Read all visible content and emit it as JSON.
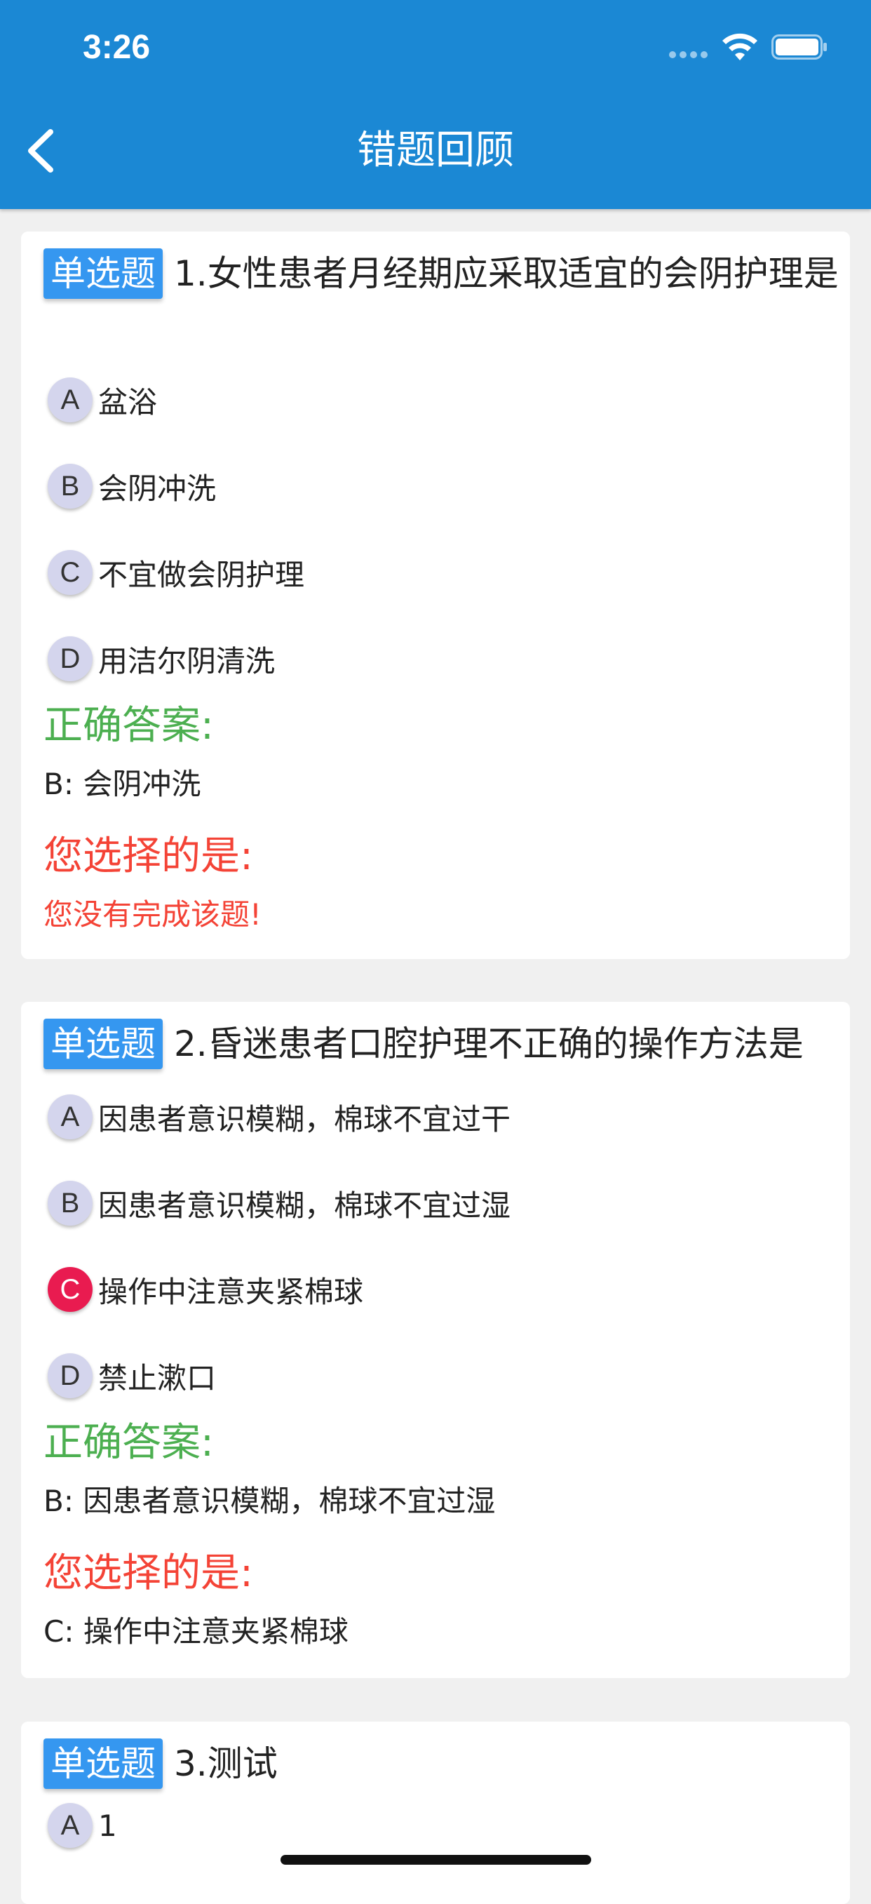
{
  "status_bar": {
    "time": "3:26",
    "icons": [
      "signal-icon",
      "wifi-icon",
      "battery-icon"
    ]
  },
  "header": {
    "title": "错题回顾",
    "back_icon": "chevron-left-icon"
  },
  "colors": {
    "header_bg": "#1b88d4",
    "badge_bg": "#3597f0",
    "correct": "#4caf50",
    "chosen": "#f44336",
    "option_circle": "#d4d5ed",
    "option_wrong": "#e91b50",
    "page_bg": "#f0f0f0"
  },
  "questions": [
    {
      "type": "单选题",
      "stem": "1.女性患者月经期应采取适宜的会阴护理是",
      "options": [
        {
          "letter": "A",
          "text": "盆浴",
          "state": "default"
        },
        {
          "letter": "B",
          "text": "会阴冲洗",
          "state": "default"
        },
        {
          "letter": "C",
          "text": "不宜做会阴护理",
          "state": "default"
        },
        {
          "letter": "D",
          "text": "用洁尔阴清洗",
          "state": "default"
        }
      ],
      "correct_label": "正确答案:",
      "correct_answer": "B: 会阴冲洗",
      "chosen_label": "您选择的是:",
      "chosen_answer": "您没有完成该题!"
    },
    {
      "type": "单选题",
      "stem": "2.昏迷患者口腔护理不正确的操作方法是",
      "options": [
        {
          "letter": "A",
          "text": "因患者意识模糊，棉球不宜过干",
          "state": "default"
        },
        {
          "letter": "B",
          "text": "因患者意识模糊，棉球不宜过湿",
          "state": "default"
        },
        {
          "letter": "C",
          "text": "操作中注意夹紧棉球",
          "state": "selected-wrong"
        },
        {
          "letter": "D",
          "text": "禁止漱口",
          "state": "default"
        }
      ],
      "correct_label": "正确答案:",
      "correct_answer": "B: 因患者意识模糊，棉球不宜过湿",
      "chosen_label": "您选择的是:",
      "chosen_answer": "C: 操作中注意夹紧棉球"
    },
    {
      "type": "单选题",
      "stem": "3.测试",
      "options": [
        {
          "letter": "A",
          "text": "1",
          "state": "default"
        }
      ]
    }
  ]
}
